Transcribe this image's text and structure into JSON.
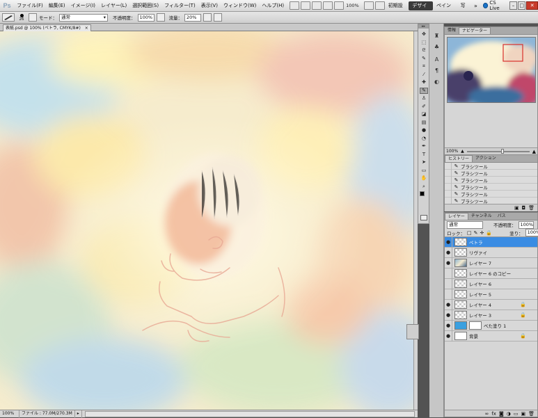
{
  "app": {
    "logo": "Ps"
  },
  "menubar": {
    "items": [
      "ファイル(F)",
      "編集(E)",
      "イメージ(I)",
      "レイヤー(L)",
      "選択範囲(S)",
      "フィルター(T)",
      "表示(V)",
      "ウィンドウ(W)",
      "ヘルプ(H)"
    ],
    "zoom": "100%",
    "workspaces": [
      "初期設定",
      "デザイン",
      "ペイント",
      "写真"
    ],
    "active_workspace": "デザイン",
    "cslive": "CS Live"
  },
  "options": {
    "brush_size": "26",
    "mode_label": "モード：",
    "mode_value": "通常",
    "opacity_label": "不透明度：",
    "opacity_value": "100%",
    "flow_label": "流量：",
    "flow_value": "20%"
  },
  "document": {
    "tab_title": "表紙.psd @ 100% (ペトラ, CMYK/8#)"
  },
  "status": {
    "zoom": "100%",
    "file": "ファイル : 77.0M/270.3M"
  },
  "colors": {
    "accent": "#3a8ce3",
    "foreground": "#000000",
    "background": "#ffffff"
  },
  "tools": [
    "move-icon",
    "marquee-icon",
    "lasso-icon",
    "quick-select-icon",
    "crop-icon",
    "eyedropper-icon",
    "healing-icon",
    "brush-icon",
    "stamp-icon",
    "history-brush-icon",
    "eraser-icon",
    "gradient-icon",
    "blur-icon",
    "dodge-icon",
    "pen-icon",
    "type-icon",
    "path-select-icon",
    "shape-icon",
    "hand-icon",
    "zoom-icon"
  ],
  "navigator": {
    "tabs": [
      "情報",
      "ナビゲーター"
    ],
    "zoom": "100%"
  },
  "history": {
    "tabs": [
      "ヒストリー",
      "アクション"
    ],
    "items": [
      "ブラシツール",
      "ブラシツール",
      "ブラシツール",
      "ブラシツール",
      "ブラシツール",
      "ブラシツール",
      "ブラシツール"
    ],
    "selected_index": 6
  },
  "layers": {
    "tabs": [
      "レイヤー",
      "チャンネル",
      "パス"
    ],
    "blend_mode": "通常",
    "opacity_label": "不透明度：",
    "opacity_value": "100%",
    "lock_label": "ロック：",
    "fill_label": "塗り：",
    "fill_value": "100%",
    "items": [
      {
        "name": "ペトラ",
        "visible": true,
        "locked": false,
        "thumb": "checker"
      },
      {
        "name": "リヴァイ",
        "visible": true,
        "locked": false,
        "thumb": "checker"
      },
      {
        "name": "レイヤー 7",
        "visible": true,
        "locked": false,
        "thumb": "image"
      },
      {
        "name": "レイヤー 6 のコピー",
        "visible": false,
        "locked": false,
        "thumb": "checker"
      },
      {
        "name": "レイヤー 6",
        "visible": false,
        "locked": false,
        "thumb": "checker"
      },
      {
        "name": "レイヤー 5",
        "visible": false,
        "locked": false,
        "thumb": "checker"
      },
      {
        "name": "レイヤー 4",
        "visible": true,
        "locked": true,
        "thumb": "checker"
      },
      {
        "name": "レイヤー 3",
        "visible": true,
        "locked": true,
        "thumb": "checker"
      },
      {
        "name": "べた塗り 1",
        "visible": true,
        "locked": false,
        "thumb": "fill"
      },
      {
        "name": "背景",
        "visible": true,
        "locked": true,
        "thumb": "white"
      }
    ],
    "selected_index": 0
  }
}
